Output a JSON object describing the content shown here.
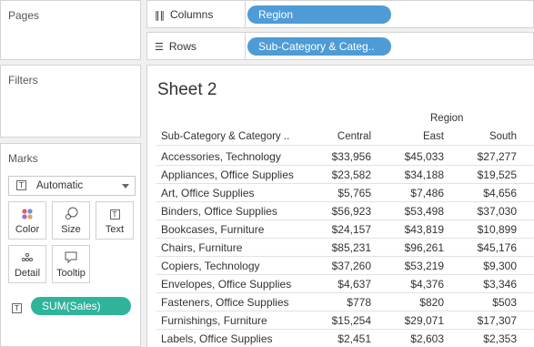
{
  "left_panel": {
    "pages_title": "Pages",
    "filters_title": "Filters",
    "marks": {
      "title": "Marks",
      "mark_type": "Automatic",
      "buttons": [
        {
          "label": "Color",
          "icon": "color-dots-icon"
        },
        {
          "label": "Size",
          "icon": "size-icon"
        },
        {
          "label": "Text",
          "icon": "text-icon"
        },
        {
          "label": "Detail",
          "icon": "detail-dots-icon"
        },
        {
          "label": "Tooltip",
          "icon": "tooltip-icon"
        }
      ],
      "field_pill": "SUM(Sales)"
    }
  },
  "shelves": {
    "columns_label": "Columns",
    "columns_pill": "Region",
    "rows_label": "Rows",
    "rows_pill": "Sub-Category & Categ.."
  },
  "sheet": {
    "title": "Sheet 2",
    "column_group_header": "Region",
    "row_header": "Sub-Category & Category ..",
    "columns": [
      "Central",
      "East",
      "South"
    ],
    "rows": [
      {
        "name": "Accessories, Technology",
        "values": [
          "$33,956",
          "$45,033",
          "$27,277"
        ]
      },
      {
        "name": "Appliances, Office Supplies",
        "values": [
          "$23,582",
          "$34,188",
          "$19,525"
        ]
      },
      {
        "name": "Art, Office Supplies",
        "values": [
          "$5,765",
          "$7,486",
          "$4,656"
        ]
      },
      {
        "name": "Binders, Office Supplies",
        "values": [
          "$56,923",
          "$53,498",
          "$37,030"
        ]
      },
      {
        "name": "Bookcases, Furniture",
        "values": [
          "$24,157",
          "$43,819",
          "$10,899"
        ]
      },
      {
        "name": "Chairs, Furniture",
        "values": [
          "$85,231",
          "$96,261",
          "$45,176"
        ]
      },
      {
        "name": "Copiers, Technology",
        "values": [
          "$37,260",
          "$53,219",
          "$9,300"
        ]
      },
      {
        "name": "Envelopes, Office Supplies",
        "values": [
          "$4,637",
          "$4,376",
          "$3,346"
        ]
      },
      {
        "name": "Fasteners, Office Supplies",
        "values": [
          "$778",
          "$820",
          "$503"
        ]
      },
      {
        "name": "Furnishings, Furniture",
        "values": [
          "$15,254",
          "$29,071",
          "$17,307"
        ]
      },
      {
        "name": "Labels, Office Supplies",
        "values": [
          "$2,451",
          "$2,603",
          "$2,353"
        ]
      }
    ]
  },
  "colors": {
    "dimension_pill": "#4e9bd6",
    "measure_pill": "#2fb39a"
  }
}
